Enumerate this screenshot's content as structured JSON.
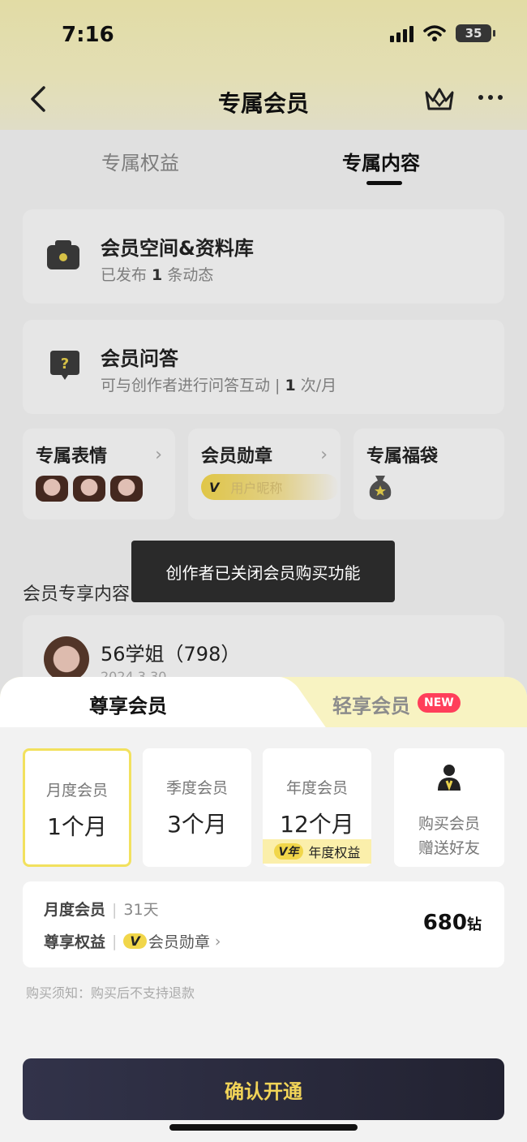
{
  "status_bar": {
    "time": "7:16",
    "battery": "35"
  },
  "nav": {
    "title": "专属会员"
  },
  "tabs": [
    {
      "label": "专属权益",
      "active": false
    },
    {
      "label": "专属内容",
      "active": true
    }
  ],
  "content_cards": [
    {
      "title": "会员空间&资料库",
      "sub_prefix": "已发布 ",
      "sub_count": "1",
      "sub_suffix": " 条动态"
    },
    {
      "title": "会员问答",
      "sub_prefix": "可与创作者进行问答互动 | ",
      "sub_count": "1",
      "sub_suffix": " 次/月"
    }
  ],
  "small_cards": {
    "stickers": {
      "title": "专属表情"
    },
    "badge": {
      "title": "会员勋章",
      "badge_v": "V",
      "badge_text": "用户昵称"
    },
    "luckybag": {
      "title": "专属福袋"
    }
  },
  "section": {
    "title": "会员专享内容"
  },
  "author": {
    "name": "56学姐（798）",
    "date": "2024.3.30"
  },
  "toast": {
    "text": "创作者已关闭会员购买功能"
  },
  "sheet": {
    "tab_left": "尊享会员",
    "tab_right": "轻享会员",
    "new_badge": "NEW",
    "plans": [
      {
        "name": "月度会员",
        "duration": "1个月",
        "selected": true
      },
      {
        "name": "季度会员",
        "duration": "3个月",
        "selected": false
      },
      {
        "name": "年度会员",
        "duration": "12个月",
        "selected": false,
        "tag_badge": "V年",
        "tag_text": "年度权益"
      }
    ],
    "gift": {
      "line1": "购买会员",
      "line2": "赠送好友"
    },
    "summary": {
      "plan_label": "月度会员",
      "days": "31天",
      "benefit_label": "尊享权益",
      "benefit_badge": "V",
      "benefit_text": "会员勋章",
      "benefit_chevron": "›",
      "price": "680",
      "price_unit": "钻"
    },
    "notice": "购买须知：购买后不支持退款",
    "confirm": "确认开通"
  },
  "colors": {
    "accent_yellow": "#f1d64a",
    "button_dark": "#2a2b3d",
    "button_text": "#f1d458",
    "new_badge": "#ff3e5a"
  }
}
